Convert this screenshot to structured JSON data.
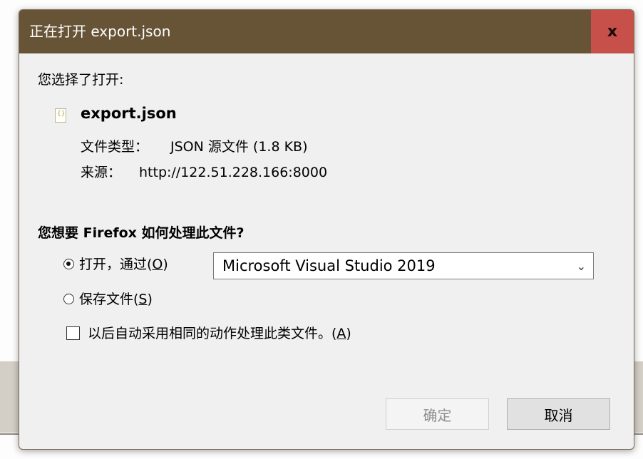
{
  "dialog": {
    "title": "正在打开 export.json",
    "close_label": "x",
    "intro": "您选择了打开:",
    "file": {
      "icon": "json-file-icon",
      "name": "export.json",
      "type_label": "文件类型：",
      "type_value": "JSON 源文件 (1.8 KB)",
      "source_label": "来源：",
      "source_value": "http://122.51.228.166:8000"
    },
    "question": "您想要 Firefox 如何处理此文件?",
    "open_with": {
      "label": "打开，通过(",
      "accesskey": "O",
      "label_end": ")",
      "selected": true,
      "app": "Microsoft Visual Studio 2019"
    },
    "save": {
      "label": "保存文件(",
      "accesskey": "S",
      "label_end": ")",
      "selected": false
    },
    "remember": {
      "label": "以后自动采用相同的动作处理此类文件。(",
      "accesskey": "A",
      "label_end": ")",
      "checked": false
    },
    "buttons": {
      "ok": "确定",
      "cancel": "取消"
    }
  },
  "colors": {
    "titlebar": "#675437",
    "close": "#c8504a",
    "body": "#f0f0f0"
  }
}
